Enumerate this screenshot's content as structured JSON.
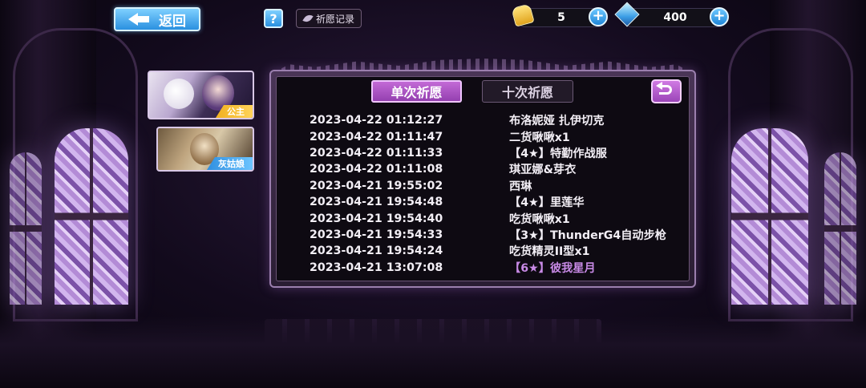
{
  "top_bar": {
    "back_label": "返回",
    "help_label": "?",
    "record_label": "祈愿记录",
    "currencies": [
      {
        "icon": "bell-icon",
        "value": "5"
      },
      {
        "icon": "crystal-icon",
        "value": "400"
      }
    ],
    "plus_label": "+"
  },
  "characters": [
    {
      "tag": "公主",
      "tag_color": "#f0b020"
    },
    {
      "tag": "灰姑娘",
      "tag_color": "#2f8fe0"
    }
  ],
  "tabs": {
    "single": "单次祈愿",
    "ten": "十次祈愿"
  },
  "records": [
    {
      "time": "2023-04-22 01:12:27",
      "item": "布洛妮娅 扎伊切克",
      "rare": false
    },
    {
      "time": "2023-04-22 01:11:47",
      "item": "二货啾啾x1",
      "rare": false
    },
    {
      "time": "2023-04-22 01:11:33",
      "item": "【4★】特勤作战服",
      "rare": false
    },
    {
      "time": "2023-04-22 01:11:08",
      "item": "琪亚娜&芽衣",
      "rare": false
    },
    {
      "time": "2023-04-21 19:55:02",
      "item": "西琳",
      "rare": false
    },
    {
      "time": "2023-04-21 19:54:48",
      "item": "【4★】里莲华",
      "rare": false
    },
    {
      "time": "2023-04-21 19:54:40",
      "item": "吃货啾啾x1",
      "rare": false
    },
    {
      "time": "2023-04-21 19:54:33",
      "item": "【3★】ThunderG4自动步枪",
      "rare": false
    },
    {
      "time": "2023-04-21 19:54:24",
      "item": "吃货精灵II型x1",
      "rare": false
    },
    {
      "time": "2023-04-21 13:07:08",
      "item": "【6★】彼我星月",
      "rare": true
    }
  ],
  "colors": {
    "accent": "#b45ccb",
    "rare_text": "#c88ae6",
    "button_blue": "#2a90e0"
  }
}
